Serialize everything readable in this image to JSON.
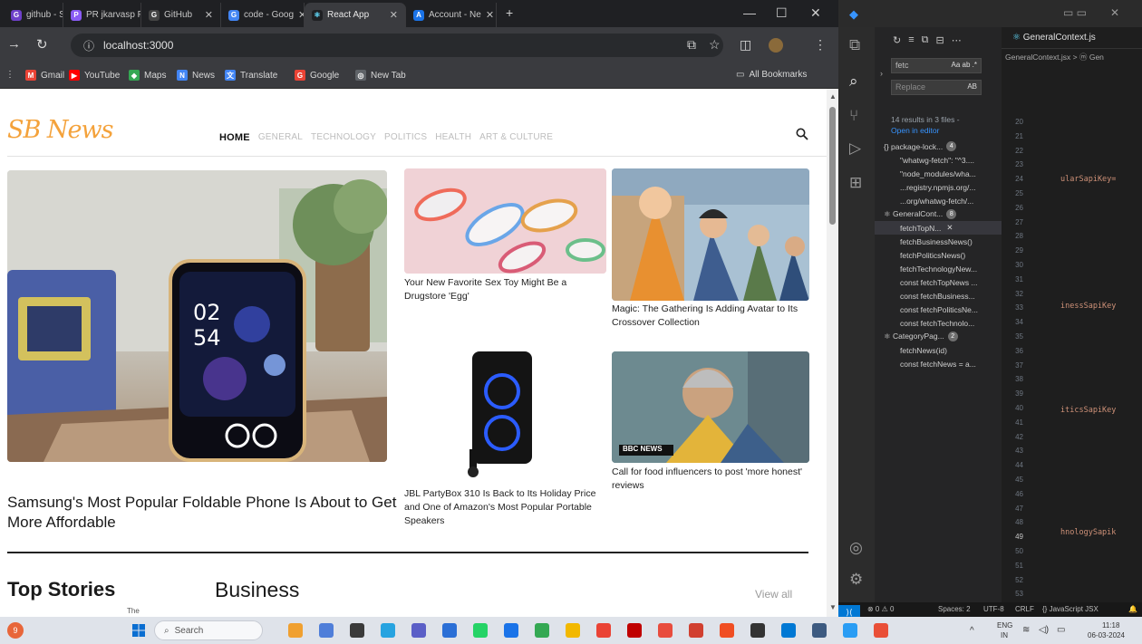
{
  "browser": {
    "tabs": [
      {
        "label": "github - Sea",
        "fav_color": "#6e40c9",
        "fav_glyph": "G"
      },
      {
        "label": "PR jkarvasp Pro",
        "fav_color": "#8a5cf5",
        "fav_glyph": "P"
      },
      {
        "label": "GitHub",
        "fav_color": "#444444",
        "fav_glyph": "G"
      },
      {
        "label": "code - Goog",
        "fav_color": "#4285f4",
        "fav_glyph": "G"
      },
      {
        "label": "React App",
        "fav_color": "#61dafb",
        "fav_glyph": "R"
      },
      {
        "label": "Account - Ne",
        "fav_color": "#1a73e8",
        "fav_glyph": "A"
      }
    ],
    "new_tab": "+",
    "url": "localhost:3000",
    "bookmarks": [
      {
        "label": "Gmail",
        "color": "#ea4335",
        "glyph": "M"
      },
      {
        "label": "YouTube",
        "color": "#ff0000",
        "glyph": "▶"
      },
      {
        "label": "Maps",
        "color": "#34a853",
        "glyph": "◆"
      },
      {
        "label": "News",
        "color": "#4285f4",
        "glyph": "N"
      },
      {
        "label": "Translate",
        "color": "#4285f4",
        "glyph": "文"
      },
      {
        "label": "Google",
        "color": "#ea4335",
        "glyph": "G"
      },
      {
        "label": "New Tab",
        "color": "#5f6368",
        "glyph": "◎"
      }
    ],
    "all_bookmarks": "All Bookmarks"
  },
  "site": {
    "logo": "SB News",
    "nav": [
      "HOME",
      "GENERAL",
      "TECHNOLOGY",
      "POLITICS",
      "HEALTH",
      "ART & CULTURE"
    ],
    "active_nav": "HOME",
    "articles": {
      "main": "Samsung's Most Popular Foldable Phone Is About to Get More Affordable",
      "a1": "Your New Favorite Sex Toy Might Be a Drugstore 'Egg'",
      "a2": "Magic: The Gathering Is Adding Avatar to Its Crossover Collection",
      "a3": "JBL PartyBox 310 Is Back to Its Holiday Price and One of Amazon's Most Popular Portable Speakers",
      "a4": "Call for food influencers to post 'more honest' reviews"
    },
    "phone_time": "02\n54",
    "bbc_tag": "BBC NEWS",
    "sections": {
      "top_stories": "Top Stories",
      "business": "Business",
      "view_all": "View all",
      "the_label": "The"
    }
  },
  "vscode": {
    "find": {
      "query": "fetc",
      "query_opts": "Aa ab .*",
      "replace": "Replace",
      "replace_opt": "AB"
    },
    "results_summary": "14 results in 3 files -",
    "open_in_editor": "Open in editor",
    "tree": [
      {
        "text": "{} package-lock...",
        "badge": "4",
        "indent": 10
      },
      {
        "text": "\"whatwg-fetch\": \"^3....",
        "indent": 28
      },
      {
        "text": "\"node_modules/wha...",
        "indent": 28
      },
      {
        "text": "...registry.npmjs.org/...",
        "indent": 28
      },
      {
        "text": "...org/whatwg-fetch/...",
        "indent": 28
      },
      {
        "text": "⚛ GeneralCont...",
        "badge": "8",
        "indent": 10
      },
      {
        "text": "fetchTopN...",
        "indent": 28,
        "selected": true
      },
      {
        "text": "fetchBusinessNews()",
        "indent": 28
      },
      {
        "text": "fetchPoliticsNews()",
        "indent": 28
      },
      {
        "text": "fetchTechnologyNew...",
        "indent": 28
      },
      {
        "text": "const fetchTopNews ...",
        "indent": 28
      },
      {
        "text": "const fetchBusiness...",
        "indent": 28
      },
      {
        "text": "const fetchPoliticsNe...",
        "indent": 28
      },
      {
        "text": "const fetchTechnolo...",
        "indent": 28
      },
      {
        "text": "⚛ CategoryPag...",
        "badge": "2",
        "indent": 10
      },
      {
        "text": "fetchNews(id)",
        "indent": 28
      },
      {
        "text": "const fetchNews = a...",
        "indent": 28
      }
    ],
    "tab_title": "GeneralContext.js",
    "breadcrumb": "GeneralContext.jsx > ⓜ Gen",
    "code_snippets": [
      "ularSapiKey=",
      "inessSapiKey",
      "iticsSapiKey",
      "hnologySapik"
    ],
    "status": {
      "errors": "⊗ 0 ⚠ 0",
      "spaces": "Spaces: 2",
      "encoding": "UTF-8",
      "eol": "CRLF",
      "lang": "{} JavaScript JSX"
    }
  },
  "taskbar": {
    "search": "Search",
    "lang": "ENG",
    "region": "IN",
    "time": "11:18",
    "date": "06-03-2024"
  }
}
